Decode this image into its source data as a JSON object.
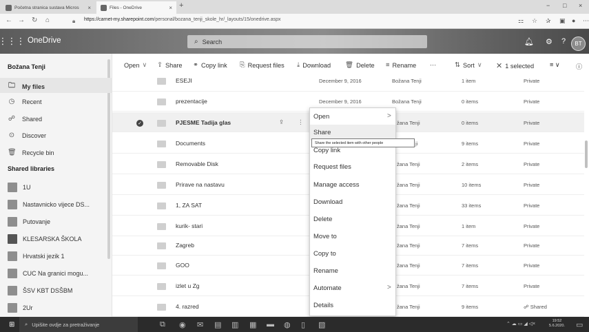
{
  "browser": {
    "tabs": [
      {
        "label": "Početna stranica sustava Micros",
        "close": "×"
      },
      {
        "label": "Files - OneDrive",
        "close": "×"
      }
    ],
    "new_tab": "+",
    "window_controls": [
      "−",
      "□",
      "×"
    ],
    "url_host": "https://carnet-my.sharepoint.com",
    "url_path": "/personal/bozana_tenji_skole_hr/_layouts/15/onedrive.aspx"
  },
  "suitebar": {
    "app_name": "OneDrive",
    "search_placeholder": "Search",
    "avatar_initials": "BT",
    "help_glyph": "?"
  },
  "leftnav": {
    "user_name": "Božana Tenji",
    "items": [
      {
        "label": "My files",
        "icon": "folder-icon"
      },
      {
        "label": "Recent",
        "icon": "clock-icon"
      },
      {
        "label": "Shared",
        "icon": "people-icon"
      },
      {
        "label": "Discover",
        "icon": "compass-icon"
      },
      {
        "label": "Recycle bin",
        "icon": "recycle-bin-icon"
      }
    ],
    "section_title": "Shared libraries",
    "libraries": [
      "1U",
      "Nastavnicko vijece DS...",
      "Putovanje",
      "KLESARSKA ŠKOLA",
      "Hrvatski jezik 1",
      "CUC Na granici mogu...",
      "ŠSV KBT DSŠBM",
      "2Ur"
    ]
  },
  "commandbar": {
    "open": "Open",
    "share": "Share",
    "copy_link": "Copy link",
    "request_files": "Request files",
    "download": "Download",
    "delete": "Delete",
    "rename": "Rename",
    "more": "···",
    "sort": "Sort",
    "selected": "1 selected"
  },
  "files": [
    {
      "name": "ESEJI",
      "modified": "December 9, 2016",
      "by": "Božana Tenji",
      "size": "1 item",
      "sharing": "Private"
    },
    {
      "name": "prezentacije",
      "modified": "December 9, 2016",
      "by": "Božana Tenji",
      "size": "0 items",
      "sharing": "Private"
    },
    {
      "name": "PJESME Tadija glas",
      "modified": "",
      "by": "žana Tenji",
      "size": "0 items",
      "sharing": "Private"
    },
    {
      "name": "Documents",
      "modified": "",
      "by": "ji",
      "size": "9 items",
      "sharing": "Private"
    },
    {
      "name": "Removable Disk",
      "modified": "",
      "by": "žana Tenji",
      "size": "2 items",
      "sharing": "Private"
    },
    {
      "name": "Prirave na nastavu",
      "modified": "",
      "by": "žana Tenji",
      "size": "10 items",
      "sharing": "Private"
    },
    {
      "name": "1, ZA SAT",
      "modified": "",
      "by": "žana Tenji",
      "size": "33 items",
      "sharing": "Private"
    },
    {
      "name": "kurik- stari",
      "modified": "",
      "by": "žana Tenji",
      "size": "1 item",
      "sharing": "Private"
    },
    {
      "name": "Zagreb",
      "modified": "",
      "by": "žana Tenji",
      "size": "7 items",
      "sharing": "Private"
    },
    {
      "name": "GOO",
      "modified": "",
      "by": "žana Tenji",
      "size": "7 items",
      "sharing": "Private"
    },
    {
      "name": "izlet u Zg",
      "modified": "",
      "by": "žana Tenji",
      "size": "7 items",
      "sharing": "Private"
    },
    {
      "name": "4. razred",
      "modified": "",
      "by": "žana Tenji",
      "size": "9 items",
      "sharing": "Shared"
    }
  ],
  "context_menu": {
    "items": [
      "Open",
      "Share",
      "Copy link",
      "Request files",
      "Manage access",
      "Download",
      "Delete",
      "Move to",
      "Copy to",
      "Rename",
      "Automate",
      "Details"
    ],
    "tooltip": "Share the selected item with other people"
  },
  "taskbar": {
    "search_placeholder": "Upišite ovdje za pretraživanje",
    "time": "19:52",
    "date": "5.6.2020."
  }
}
